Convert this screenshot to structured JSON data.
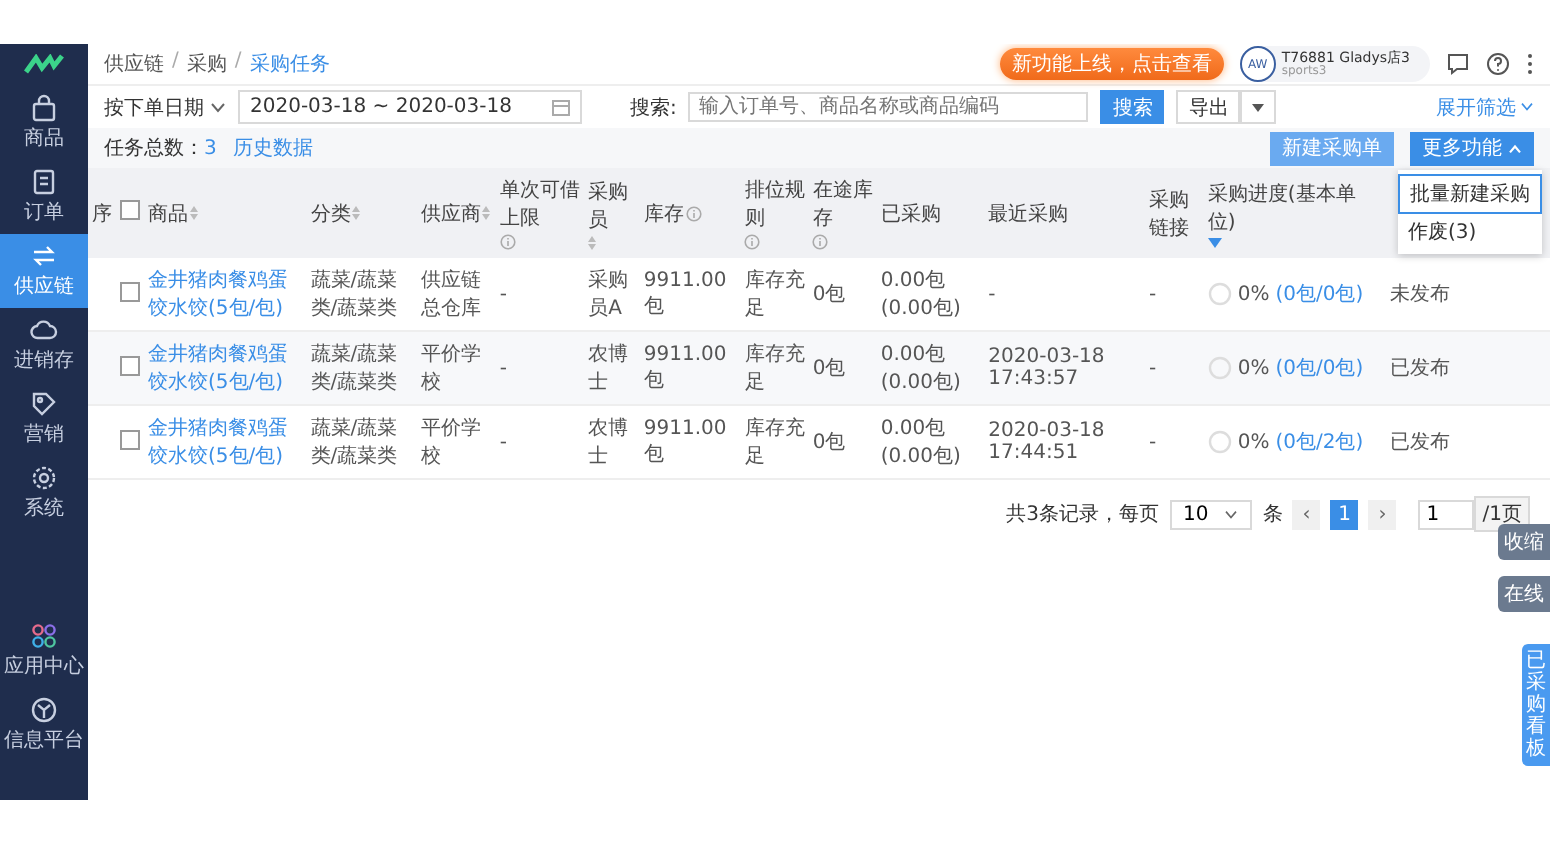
{
  "sidebar": {
    "items": [
      {
        "label": "商品",
        "selected": false
      },
      {
        "label": "订单",
        "selected": false
      },
      {
        "label": "供应链",
        "selected": true
      },
      {
        "label": "进销存",
        "selected": false
      },
      {
        "label": "营销",
        "selected": false
      },
      {
        "label": "系统",
        "selected": false
      }
    ],
    "bottom_items": [
      {
        "label": "应用中心",
        "selected": false
      },
      {
        "label": "信息平台",
        "selected": false
      }
    ]
  },
  "header": {
    "breadcrumb": [
      {
        "label": "供应链",
        "current": false
      },
      {
        "label": "采购",
        "current": false
      },
      {
        "label": "采购任务",
        "current": true
      }
    ],
    "breadcrumb_separator": "/",
    "promo": "新功能上线，点击查看",
    "user": {
      "avatar": "AW",
      "name": "T76881 Gladys店3",
      "sub": "sports3"
    }
  },
  "filters": {
    "date_type": "按下单日期",
    "date_range": "2020-03-18 ~ 2020-03-18",
    "search_label": "搜索:",
    "search_placeholder": "输入订单号、商品名称或商品编码",
    "search_button": "搜索",
    "export_button": "导出",
    "expand": "展开筛选"
  },
  "summary": {
    "total_label": "任务总数：",
    "total": "3",
    "history": "历史数据"
  },
  "actions": {
    "new_button": "新建采购单",
    "more_button": "更多功能",
    "more_expanded": true,
    "menu": [
      {
        "label": "批量新建采购",
        "selected": true
      },
      {
        "label": "作废(3)",
        "selected": false
      }
    ]
  },
  "table": {
    "columns": [
      {
        "label": "序",
        "sort": false,
        "info": false,
        "filter": false,
        "kind": "text"
      },
      {
        "kind": "check",
        "checked": false
      },
      {
        "label": "商品",
        "sort": true,
        "info": false,
        "filter": false,
        "kind": "text"
      },
      {
        "label": "分类",
        "sort": true,
        "info": false,
        "filter": false,
        "kind": "text"
      },
      {
        "label": "供应商",
        "sort": true,
        "info": false,
        "filter": false,
        "kind": "text"
      },
      {
        "label": "单次可借上限",
        "sort": false,
        "info": true,
        "filter": false,
        "kind": "text"
      },
      {
        "label": "采购员",
        "sort": true,
        "info": false,
        "filter": false,
        "kind": "text"
      },
      {
        "label": "库存",
        "sort": false,
        "info": true,
        "filter": false,
        "kind": "text"
      },
      {
        "label": "排位规则",
        "sort": false,
        "info": true,
        "filter": false,
        "kind": "text"
      },
      {
        "label": "在途库存",
        "sort": false,
        "info": true,
        "filter": false,
        "kind": "text"
      },
      {
        "label": "已采购",
        "sort": false,
        "info": false,
        "filter": false,
        "kind": "text"
      },
      {
        "label": "最近采购",
        "sort": false,
        "info": false,
        "filter": false,
        "kind": "text"
      },
      {
        "label": "采购链接",
        "sort": false,
        "info": false,
        "filter": false,
        "kind": "text"
      },
      {
        "label": "采购进度(基本单位)",
        "sort": false,
        "info": false,
        "filter": true,
        "kind": "text"
      },
      {
        "kind": "blank"
      }
    ],
    "rows": [
      {
        "checked": false,
        "product": "金井猪肉餐鸡蛋饺水饺(5包/包)",
        "category": "蔬菜/蔬菜类/蔬菜类",
        "supplier": "供应链总仓库",
        "limit": "-",
        "buyer": "采购员A",
        "stock": "9911.00包",
        "rule": "库存充足",
        "in_transit": "0包",
        "purchased": "0.00包(0.00包)",
        "last_time": "-",
        "link": "-",
        "level": 0,
        "pct": "0%",
        "qty": "(0包/0包)",
        "status": "未发布"
      },
      {
        "checked": false,
        "product": "金井猪肉餐鸡蛋饺水饺(5包/包)",
        "category": "蔬菜/蔬菜类/蔬菜类",
        "supplier": "平价学校",
        "limit": "-",
        "buyer": "农博士",
        "stock": "9911.00包",
        "rule": "库存充足",
        "in_transit": "0包",
        "purchased": "0.00包(0.00包)",
        "last_time": "2020-03-18 17:43:57",
        "link": "-",
        "level": 0,
        "pct": "0%",
        "qty": "(0包/0包)",
        "status": "已发布"
      },
      {
        "checked": false,
        "product": "金井猪肉餐鸡蛋饺水饺(5包/包)",
        "category": "蔬菜/蔬菜类/蔬菜类",
        "supplier": "平价学校",
        "limit": "-",
        "buyer": "农博士",
        "stock": "9911.00包",
        "rule": "库存充足",
        "in_transit": "0包",
        "purchased": "0.00包(0.00包)",
        "last_time": "2020-03-18 17:44:51",
        "link": "-",
        "level": 0,
        "pct": "0%",
        "qty": "(0包/2包)",
        "status": "已发布"
      }
    ]
  },
  "pagination": {
    "total_text": "共3条记录，每页",
    "page_size": "10",
    "unit": "条",
    "prev": "‹",
    "pages": [
      {
        "label": "1",
        "selected": true
      }
    ],
    "next": "›",
    "jump_value": "1",
    "jump_suffix": "/1页"
  },
  "side_tabs": [
    {
      "label": "收缩",
      "kind": "grey"
    },
    {
      "label": "在线",
      "kind": "grey"
    },
    {
      "label": "已采购看板",
      "kind": "vertical"
    }
  ]
}
